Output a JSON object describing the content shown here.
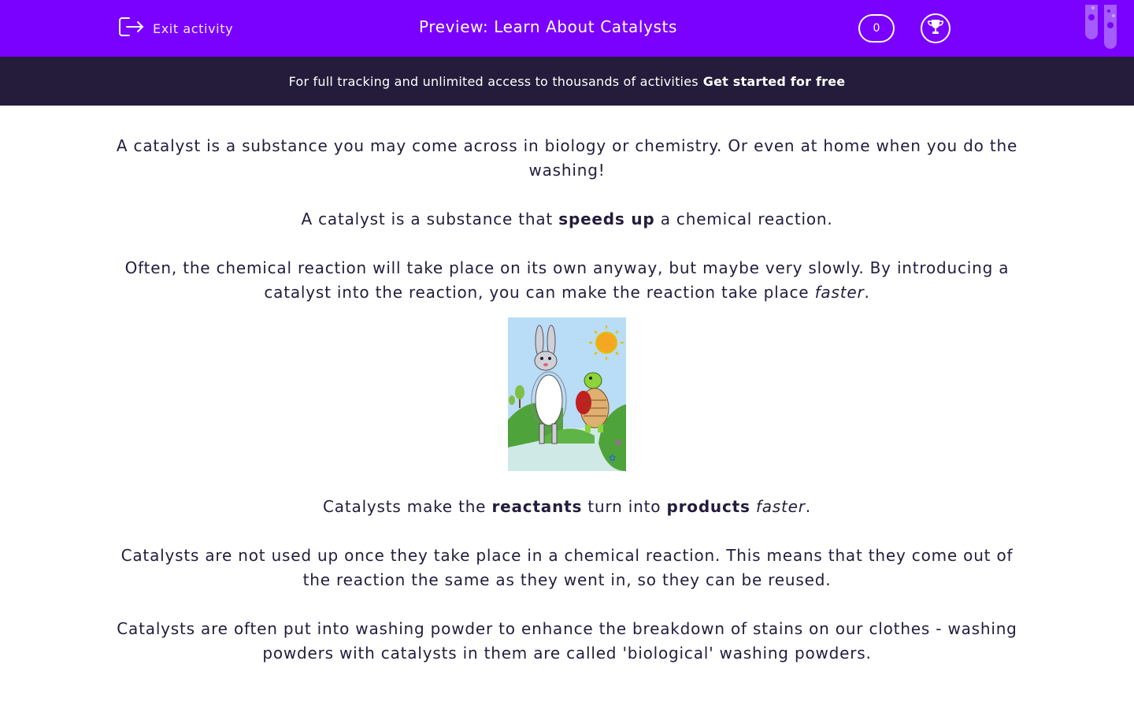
{
  "header": {
    "exit_label": "Exit activity",
    "title": "Preview: Learn About Catalysts",
    "score": "0",
    "bg_color": "#7a00ff"
  },
  "banner": {
    "text": "For full tracking and unlimited access to thousands of activities",
    "cta": "Get started for free",
    "bg_color": "#241c3a"
  },
  "content": {
    "p1": "A catalyst is a substance you may come across in biology or chemistry. Or even at home when you do the washing!",
    "p2": {
      "before": "A catalyst is a substance that",
      "bold": "speeds up",
      "after": "a chemical reaction."
    },
    "p3": {
      "before": "Often, the chemical reaction will take place on its own anyway, but maybe very slowly. By introducing a catalyst into the reaction, you can make the reaction take place",
      "italic": "faster",
      "after": "."
    },
    "p4": {
      "before": "Catalysts make the",
      "bold1": "reactants",
      "middle": "turn into",
      "bold2": "products",
      "italic": "faster",
      "after": "."
    },
    "p5": "Catalysts are not used up once they take place in a chemical reaction. This means that they come out of the reaction the same as they went in, so they can be reused.",
    "p6": "Catalysts are often put into washing powder to enhance the breakdown of stains on our clothes - washing powders with catalysts in them are called 'biological' washing powders."
  },
  "icons": {
    "exit": "exit-icon",
    "trophy": "trophy-icon",
    "tubes": "test-tubes-icon",
    "illustration": "hare-and-tortoise-illustration"
  }
}
